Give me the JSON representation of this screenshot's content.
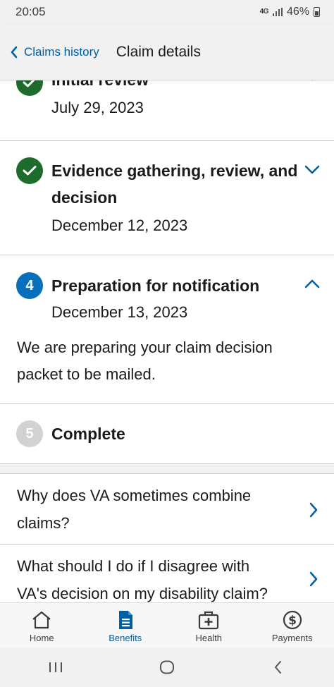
{
  "status_bar": {
    "time": "20:05",
    "network": "4G",
    "battery": "46%"
  },
  "header": {
    "back_label": "Claims history",
    "title": "Claim details"
  },
  "colors": {
    "accent": "#005ea2",
    "complete": "#1e6b2e",
    "current": "#0a6fba",
    "pending": "#d2d2d2"
  },
  "steps": [
    {
      "title": "Initial review",
      "date": "July 29, 2023",
      "status": "complete",
      "icon": "check-icon",
      "expanded": false
    },
    {
      "title_line1": "Evidence gathering, review, and",
      "title_line2": "decision",
      "date": "December 12, 2023",
      "status": "complete",
      "icon": "check-icon",
      "expanded": false
    },
    {
      "number": "4",
      "title": "Preparation for notification",
      "date": "December 13, 2023",
      "status": "current",
      "expanded": true,
      "desc_line1": "We are preparing your claim decision",
      "desc_line2": "packet to be mailed."
    },
    {
      "number": "5",
      "title": "Complete",
      "status": "pending"
    }
  ],
  "faqs": [
    {
      "line1": "Why does VA sometimes combine",
      "line2": "claims?"
    },
    {
      "line1": "What should I do if I disagree with",
      "line2": "VA's decision on my disability claim?"
    }
  ],
  "tabs": [
    {
      "label": "Home",
      "icon": "home-icon"
    },
    {
      "label": "Benefits",
      "icon": "benefits-document-icon",
      "active": true
    },
    {
      "label": "Health",
      "icon": "medical-kit-icon"
    },
    {
      "label": "Payments",
      "icon": "dollar-icon"
    }
  ]
}
